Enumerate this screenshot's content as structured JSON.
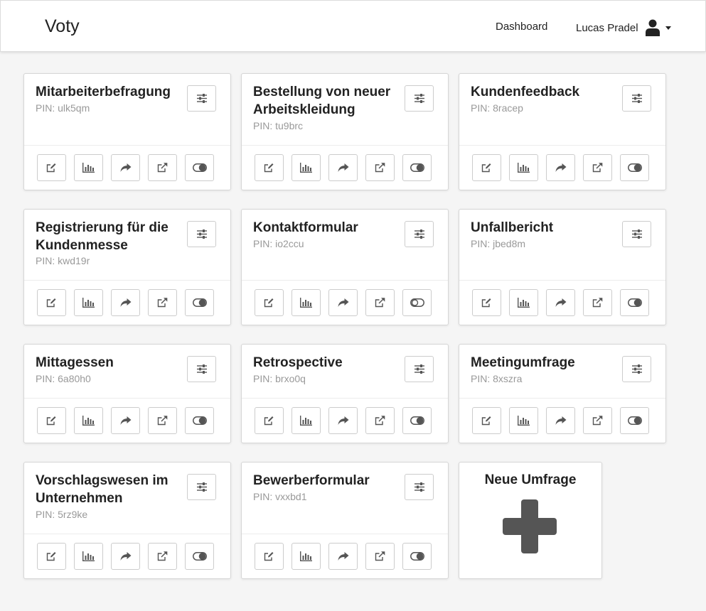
{
  "app": {
    "brand": "Voty"
  },
  "nav": {
    "dashboard": "Dashboard",
    "user_name": "Lucas Pradel"
  },
  "surveys": [
    {
      "title": "Mitarbeiterbefragung",
      "pin": "PIN: ulk5qm",
      "active": true
    },
    {
      "title": "Bestellung von neuer Arbeitskleidung",
      "pin": "PIN: tu9brc",
      "active": true
    },
    {
      "title": "Kundenfeedback",
      "pin": "PIN: 8racep",
      "active": true
    },
    {
      "title": "Registrierung für die Kundenmesse",
      "pin": "PIN: kwd19r",
      "active": true
    },
    {
      "title": "Kontaktformular",
      "pin": "PIN: io2ccu",
      "active": false
    },
    {
      "title": "Unfallbericht",
      "pin": "PIN: jbed8m",
      "active": true
    },
    {
      "title": "Mittagessen",
      "pin": "PIN: 6a80h0",
      "active": true
    },
    {
      "title": "Retrospective",
      "pin": "PIN: brxo0q",
      "active": true
    },
    {
      "title": "Meetingumfrage",
      "pin": "PIN: 8xszra",
      "active": true
    },
    {
      "title": "Vorschlagswesen im Unternehmen",
      "pin": "PIN: 5rz9ke",
      "active": true
    },
    {
      "title": "Bewerberformular",
      "pin": "PIN: vxxbd1",
      "active": true
    }
  ],
  "new_survey": {
    "label": "Neue Umfrage"
  },
  "icons": {
    "settings": "sliders-icon",
    "edit": "edit-icon",
    "results": "bar-chart-icon",
    "share": "share-icon",
    "open": "external-link-icon",
    "toggle": "toggle-icon",
    "user": "user-icon",
    "add": "plus-icon"
  },
  "colors": {
    "icon": "#555555",
    "plus": "#555555",
    "pin": "#999999"
  }
}
